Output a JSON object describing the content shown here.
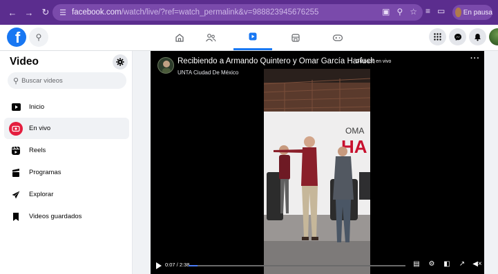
{
  "browser": {
    "url_host": "facebook.com",
    "url_path": "/watch/live/?ref=watch_permalink&v=988823945676255",
    "profile_status": "En pausa",
    "nav_icons": [
      "arrow-left-icon",
      "arrow-right-icon",
      "reload-icon",
      "site-settings-icon"
    ],
    "omnibox_icons": [
      "install-app-icon",
      "zoom-icon",
      "bookmark-star-icon"
    ],
    "toolbar_icons": [
      "reading-list-icon",
      "side-panel-icon"
    ]
  },
  "facebook": {
    "logo_letter": "f",
    "nav_tabs": [
      "home-icon",
      "friends-icon",
      "video-icon",
      "marketplace-icon",
      "gaming-icon"
    ],
    "active_tab": "video-icon",
    "accent": "#1877f2",
    "right_icons": [
      "menu-grid-icon",
      "messenger-icon",
      "bell-icon",
      "profile-avatar"
    ]
  },
  "sidebar": {
    "title": "Video",
    "search_placeholder": "Buscar videos",
    "items": [
      {
        "label": "Inicio",
        "icon": "watch-home-icon",
        "active": false
      },
      {
        "label": "En vivo",
        "icon": "live-icon",
        "active": true
      },
      {
        "label": "Reels",
        "icon": "reels-icon",
        "active": false
      },
      {
        "label": "Programas",
        "icon": "shows-icon",
        "active": false
      },
      {
        "label": "Explorar",
        "icon": "explore-icon",
        "active": false
      },
      {
        "label": "Videos guardados",
        "icon": "saved-bookmark-icon",
        "active": false
      }
    ],
    "live_color": "#e41e3f"
  },
  "video": {
    "title": "Recibiendo a Armando Quintero y Omar García Harfuch",
    "tag": "Grabado en vivo",
    "channel": "UNTA Ciudad De México",
    "time": "0:07 / 2:38",
    "progress": 0.04,
    "backdrop_text": "OMA",
    "backdrop_text_2": "HA",
    "control_icons": [
      "captions-icon",
      "settings-icon",
      "pip-icon",
      "fullscreen-icon",
      "volume-muted-icon"
    ]
  }
}
